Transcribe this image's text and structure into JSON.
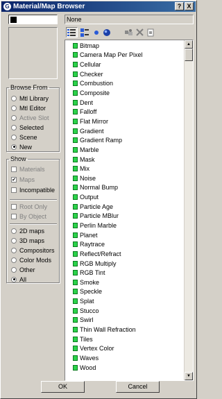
{
  "window": {
    "title": "Material/Map Browser",
    "app_icon": "3ds-max-icon",
    "help_label": "?",
    "close_label": "X"
  },
  "name_field": {
    "value": ""
  },
  "selected_map": "None",
  "browse_from": {
    "legend": "Browse From",
    "options": [
      {
        "label": "Mtl Library",
        "checked": false,
        "enabled": true
      },
      {
        "label": "Mtl Editor",
        "checked": false,
        "enabled": true
      },
      {
        "label": "Active Slot",
        "checked": false,
        "enabled": false
      },
      {
        "label": "Selected",
        "checked": false,
        "enabled": true
      },
      {
        "label": "Scene",
        "checked": false,
        "enabled": true
      },
      {
        "label": "New",
        "checked": true,
        "enabled": true
      }
    ]
  },
  "show": {
    "legend": "Show",
    "checks": [
      {
        "label": "Materials",
        "checked": false,
        "enabled": false
      },
      {
        "label": "Maps",
        "checked": true,
        "enabled": false
      },
      {
        "label": "Incompatible",
        "checked": false,
        "enabled": true
      }
    ],
    "checks2": [
      {
        "label": "Root Only",
        "checked": false,
        "enabled": false
      },
      {
        "label": "By Object",
        "checked": false,
        "enabled": false
      }
    ],
    "radios": [
      {
        "label": "2D maps",
        "checked": false
      },
      {
        "label": "3D maps",
        "checked": false
      },
      {
        "label": "Compositors",
        "checked": false
      },
      {
        "label": "Color Mods",
        "checked": false
      },
      {
        "label": "Other",
        "checked": false
      },
      {
        "label": "All",
        "checked": true
      }
    ]
  },
  "toolbar": {
    "buttons": [
      {
        "icon": "view-list-icon",
        "active": true
      },
      {
        "icon": "view-list-icons-icon",
        "active": false
      },
      {
        "icon": "view-small-icons-icon",
        "active": false
      },
      {
        "icon": "view-large-icons-icon",
        "active": false
      },
      {
        "icon": "update-scene-materials-icon",
        "active": false
      },
      {
        "icon": "delete-icon",
        "active": false
      },
      {
        "icon": "clear-library-icon",
        "active": false
      }
    ]
  },
  "maps": [
    "Bitmap",
    "Camera Map Per Pixel",
    "Cellular",
    "Checker",
    "Combustion",
    "Composite",
    "Dent",
    "Falloff",
    "Flat Mirror",
    "Gradient",
    "Gradient Ramp",
    "Marble",
    "Mask",
    "Mix",
    "Noise",
    "Normal Bump",
    "Output",
    "Particle Age",
    "Particle MBlur",
    "Perlin Marble",
    "Planet",
    "Raytrace",
    "Reflect/Refract",
    "RGB Multiply",
    "RGB Tint",
    "Smoke",
    "Speckle",
    "Splat",
    "Stucco",
    "Swirl",
    "Thin Wall Refraction",
    "Tiles",
    "Vertex Color",
    "Waves",
    "Wood"
  ],
  "buttons": {
    "ok": "OK",
    "cancel": "Cancel"
  },
  "colors": {
    "map_icon": "#2bd24a",
    "title_bar": "#0a246a",
    "face": "#d4d0c8"
  }
}
